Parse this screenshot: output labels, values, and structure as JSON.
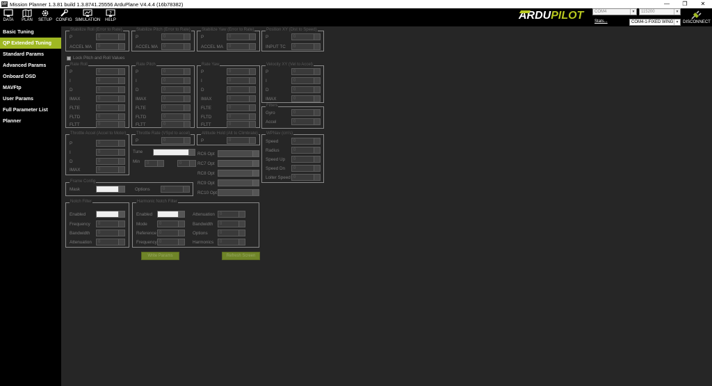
{
  "window": {
    "title": "Mission Planner 1.3.81 build 1.3.8741.25556 ArduPlane V4.4.4 (16b78382)",
    "minimize": "—",
    "maximize": "❐",
    "close": "✕"
  },
  "toolbar": {
    "items": [
      {
        "label": "DATA",
        "icon": "monitor-icon"
      },
      {
        "label": "PLAN",
        "icon": "map-icon"
      },
      {
        "label": "SETUP",
        "icon": "gear-icon"
      },
      {
        "label": "CONFIG",
        "icon": "wrench-icon"
      },
      {
        "label": "SIMULATION",
        "icon": "simulation-icon"
      },
      {
        "label": "HELP",
        "icon": "help-icon"
      }
    ]
  },
  "connection": {
    "logo_left": "ARDU",
    "logo_right": "PILOT",
    "port": "COM4",
    "baud": "115200",
    "stats": "Stats...",
    "vehicle": "COM4-1-FIXED WING",
    "disconnect": "DISCONNECT"
  },
  "sidebar": {
    "items": [
      "Basic Tuning",
      "QP Extended Tuning",
      "Standard Params",
      "Advanced Params",
      "Onboard OSD",
      "MAVFtp",
      "User Params",
      "Full Parameter List",
      "Planner"
    ],
    "active_index": 1
  },
  "groups": {
    "g1": {
      "title": "Stabilize Roll (Error to Rate)",
      "p": "P",
      "accel": "ACCEL MA"
    },
    "g2": {
      "title": "Stabilize Pitch (Error to Rate)",
      "p": "P",
      "accel": "ACCEL MA"
    },
    "g3": {
      "title": "Stabilize Yaw (Error to Rate)",
      "p": "P",
      "accel": "ACCEL MA"
    },
    "g4": {
      "title": "Position XY (Dist to Speed)",
      "p": "P",
      "input": "INPUT TC"
    },
    "lock": "Lock Pitch and Roll Values",
    "rr": {
      "title": "Rate Roll",
      "labels": [
        "P",
        "I",
        "D",
        "IMAX",
        "FLTE",
        "FLTD",
        "FLTT"
      ]
    },
    "rp": {
      "title": "Rate Pitch",
      "labels": [
        "P",
        "I",
        "D",
        "IMAX",
        "FLTE",
        "FLTD",
        "FLTT"
      ]
    },
    "ry": {
      "title": "Rate Yaw",
      "labels": [
        "P",
        "I",
        "D",
        "IMAX",
        "FLTE",
        "FLTD",
        "FLTT"
      ]
    },
    "vxy": {
      "title": "Velocity XY (Vel to Accel)",
      "labels": [
        "P",
        "I",
        "D",
        "IMAX"
      ]
    },
    "filters": {
      "title": "Filters",
      "labels": [
        "Gyro",
        "Accel"
      ]
    },
    "thracc": {
      "title": "Throttle Accel (Accel to Motor)",
      "labels": [
        "P",
        "I",
        "D",
        "IMAX"
      ]
    },
    "thrrate": {
      "title": "Throttle Rate (VSpd to accel)",
      "p": "P",
      "tune": "Tune",
      "min": "Min"
    },
    "althold": {
      "title": "Altitude Hold (Alt to Climbrate)",
      "p": "P",
      "rc": [
        "RC6 Opt",
        "RC7 Opt",
        "RC8 Opt",
        "RC9 Opt",
        "RC10 Opt"
      ]
    },
    "wpnav": {
      "title": "WPNav (cm's)",
      "labels": [
        "Speed",
        "Radius",
        "Speed Up",
        "Speed Dn",
        "Loiter Speed"
      ]
    },
    "frame": {
      "title": "Frame Config",
      "mask": "Mask",
      "options": "Options"
    },
    "notch": {
      "title": "Notch Filter",
      "labels": [
        "Enabled",
        "Frequency",
        "Bandwidth",
        "Attenuation"
      ]
    },
    "harm": {
      "title": "Harmonic Notch Filter",
      "left": [
        "Enabled",
        "Mode",
        "Reference",
        "Frequency"
      ],
      "right": [
        "Attenuation",
        "Bandwidth",
        "Options",
        "Harmonics"
      ]
    }
  },
  "buttons": {
    "write": "Write Params",
    "refresh": "Refresh Screen"
  },
  "colors": {
    "accent": "#9fb822",
    "background": "#262626",
    "toolbar": "#000000"
  }
}
